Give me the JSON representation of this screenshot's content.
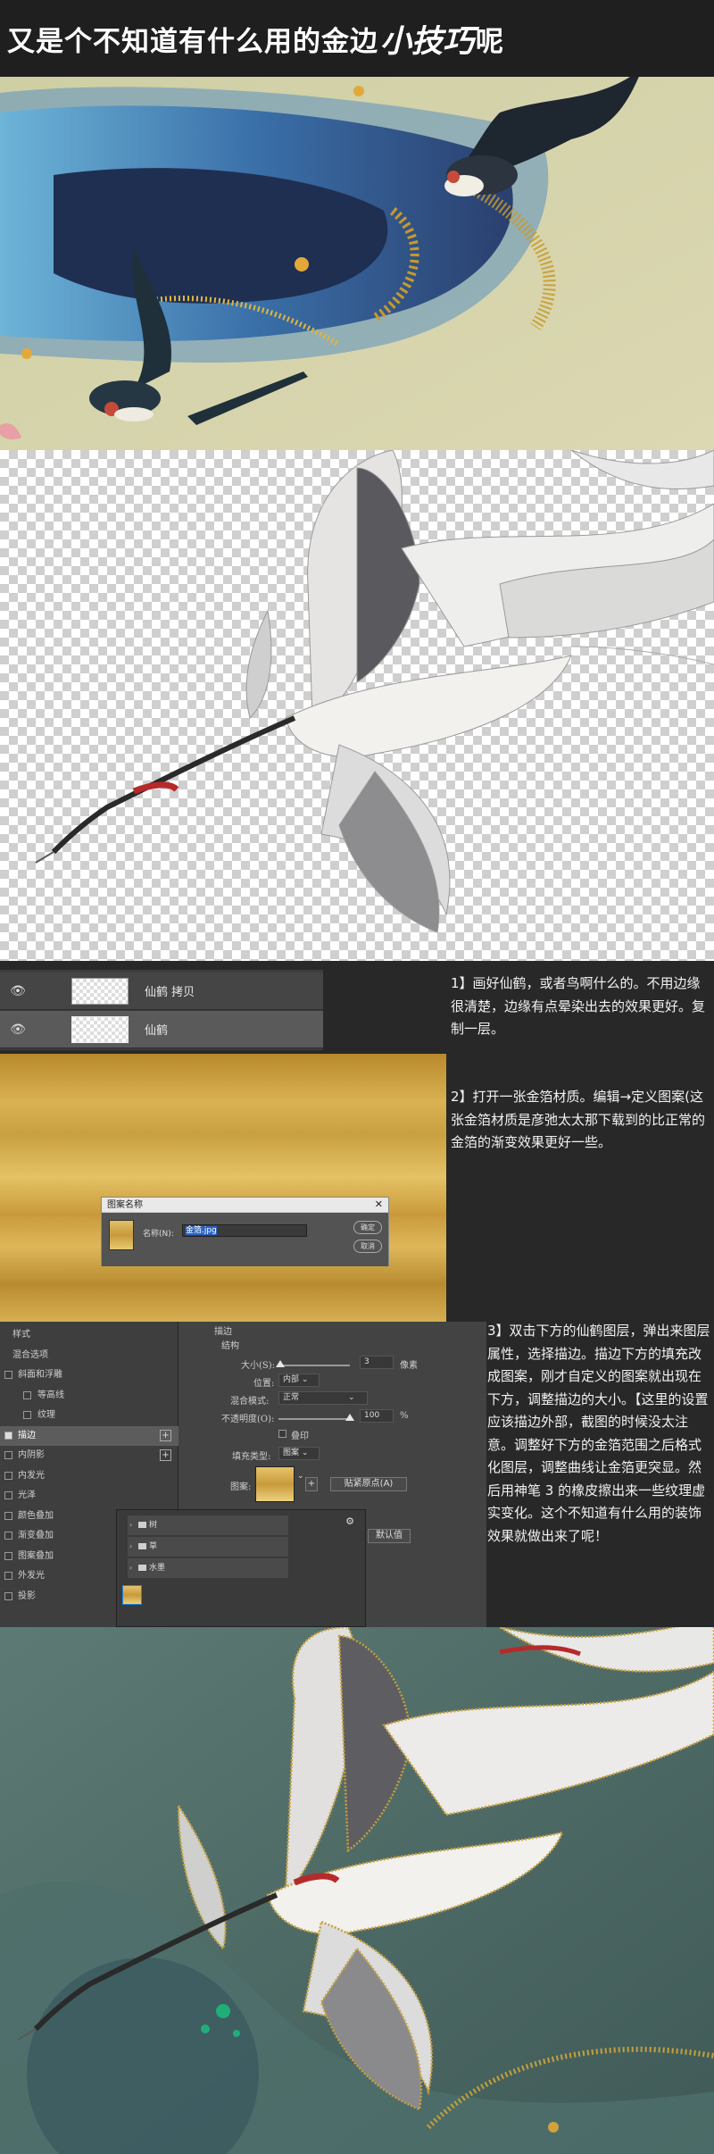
{
  "header": {
    "title_part1": "又是个不知道有什么用的金边",
    "title_stylized": "小技巧",
    "title_part2": "呢"
  },
  "layers": [
    {
      "name": "仙鹤 拷贝",
      "selected": false
    },
    {
      "name": "仙鹤",
      "selected": true
    }
  ],
  "pattern_dialog": {
    "title": "图案名称",
    "name_label": "名称(N):",
    "name_value": "金箔.jpg",
    "ok": "确定",
    "cancel": "取消"
  },
  "layer_style_list": [
    {
      "label": "样式",
      "check": false,
      "has_checkbox": false,
      "plus": false,
      "indent": false,
      "selected": false
    },
    {
      "label": "混合选项",
      "check": false,
      "has_checkbox": false,
      "plus": false,
      "indent": false,
      "selected": false
    },
    {
      "label": "斜面和浮雕",
      "check": false,
      "has_checkbox": true,
      "plus": false,
      "indent": false,
      "selected": false
    },
    {
      "label": "等高线",
      "check": false,
      "has_checkbox": true,
      "plus": false,
      "indent": true,
      "selected": false
    },
    {
      "label": "纹理",
      "check": false,
      "has_checkbox": true,
      "plus": false,
      "indent": true,
      "selected": false
    },
    {
      "label": "描边",
      "check": true,
      "has_checkbox": true,
      "plus": true,
      "indent": false,
      "selected": true
    },
    {
      "label": "内阴影",
      "check": false,
      "has_checkbox": true,
      "plus": true,
      "indent": false,
      "selected": false
    },
    {
      "label": "内发光",
      "check": false,
      "has_checkbox": true,
      "plus": false,
      "indent": false,
      "selected": false
    },
    {
      "label": "光泽",
      "check": false,
      "has_checkbox": true,
      "plus": false,
      "indent": false,
      "selected": false
    },
    {
      "label": "颜色叠加",
      "check": false,
      "has_checkbox": true,
      "plus": true,
      "indent": false,
      "selected": false
    },
    {
      "label": "渐变叠加",
      "check": false,
      "has_checkbox": true,
      "plus": true,
      "indent": false,
      "selected": false
    },
    {
      "label": "图案叠加",
      "check": false,
      "has_checkbox": true,
      "plus": false,
      "indent": false,
      "selected": false
    },
    {
      "label": "外发光",
      "check": false,
      "has_checkbox": true,
      "plus": false,
      "indent": false,
      "selected": false
    },
    {
      "label": "投影",
      "check": false,
      "has_checkbox": true,
      "plus": true,
      "indent": false,
      "selected": false
    }
  ],
  "stroke_panel": {
    "heading": "描边",
    "structure": "结构",
    "size_label": "大小(S):",
    "size_value": "3",
    "size_unit": "像素",
    "size_level": 0.03,
    "position_label": "位置:",
    "position_value": "内部",
    "blend_label": "混合模式:",
    "blend_value": "正常",
    "opacity_label": "不透明度(O):",
    "opacity_value": "100",
    "opacity_unit": "%",
    "opacity_level": 1.0,
    "overprint_label": "叠印",
    "fill_type_label": "填充类型:",
    "fill_type_value": "图案",
    "pattern_label": "图案:",
    "snap_button": "贴紧原点(A)",
    "default_partial": "默认值",
    "folders": [
      "树",
      "草",
      "水墨"
    ]
  },
  "steps": {
    "step1": "1】画好仙鹤，或者鸟啊什么的。不用边缘很清楚，边缘有点晕染出去的效果更好。复制一层。",
    "step2": "2】打开一张金箔材质。编辑→定义图案(这张金箔材质是彦弛太太那下载到的比正常的金箔的渐变效果更好一些。",
    "step3": "3】双击下方的仙鹤图层，弹出来图层属性，选择描边。描边下方的填充改成图案，刚才自定义的图案就出现在下方，调整描边的大小。【这里的设置应该描边外部，截图的时候没太注意。调整好下方的金箔范围之后格式化图层，调整曲线让金箔更突显。然后用神笔 3 的橡皮擦出来一些纹理虚实变化。这个不知道有什么用的装饰效果就做出来了呢！"
  },
  "colors": {
    "header_bg": "#1f1f1f",
    "panel_bg": "#282828",
    "gold": "#d4ac4f",
    "swallow_bg": "#d8d6ac",
    "final_bg": "#4a6660"
  }
}
